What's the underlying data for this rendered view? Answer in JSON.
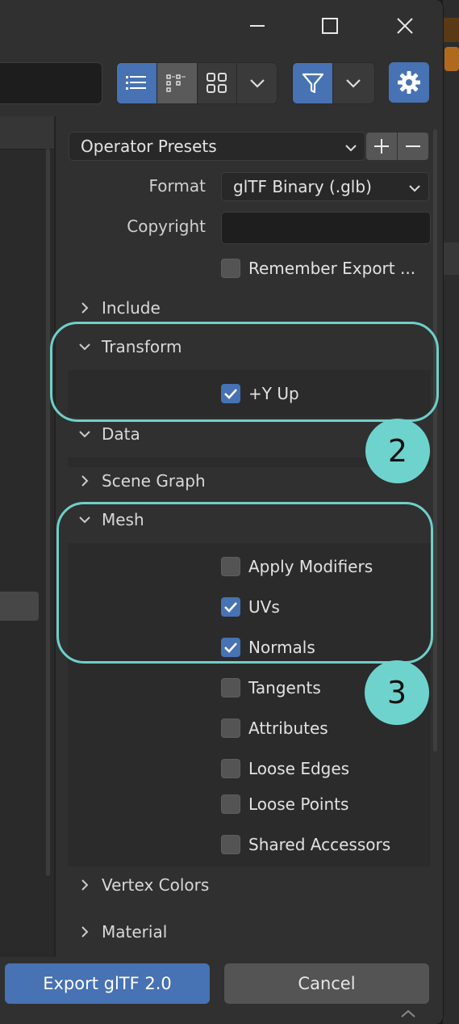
{
  "titlebar": {
    "minimize_icon": "minimize-icon",
    "maximize_icon": "maximize-icon",
    "close_icon": "close-icon"
  },
  "toolbar": {
    "view_modes": [
      "vertical-list-icon",
      "horizontal-list-icon",
      "thumbnails-icon"
    ],
    "active_view": "vertical-list-icon"
  },
  "panel": {
    "operator_presets": "Operator Presets",
    "format_label": "Format",
    "format_value": "glTF Binary (.glb)",
    "copyright_label": "Copyright",
    "copyright_value": "",
    "remember_export": "Remember Export ...",
    "remember_export_checked": false,
    "sections": {
      "include": "Include",
      "transform": "Transform",
      "data": "Data",
      "scene_graph": "Scene Graph",
      "mesh": "Mesh",
      "vertex_colors": "Vertex Colors",
      "material": "Material"
    },
    "transform_options": {
      "y_up": "+Y Up",
      "y_up_checked": true
    },
    "mesh_options": [
      {
        "label": "Apply Modifiers",
        "checked": false
      },
      {
        "label": "UVs",
        "checked": true
      },
      {
        "label": "Normals",
        "checked": true
      },
      {
        "label": "Tangents",
        "checked": false
      },
      {
        "label": "Attributes",
        "checked": false
      },
      {
        "label": "Loose Edges",
        "checked": false
      },
      {
        "label": "Loose Points",
        "checked": false
      },
      {
        "label": "Shared Accessors",
        "checked": false
      }
    ]
  },
  "annotations": {
    "callout_2": "2",
    "callout_3": "3",
    "color": "#6fd3cd"
  },
  "footer": {
    "export_label": "Export glTF 2.0",
    "cancel_label": "Cancel"
  },
  "colors": {
    "accent": "#4772b3",
    "panel_bg": "#303030"
  }
}
